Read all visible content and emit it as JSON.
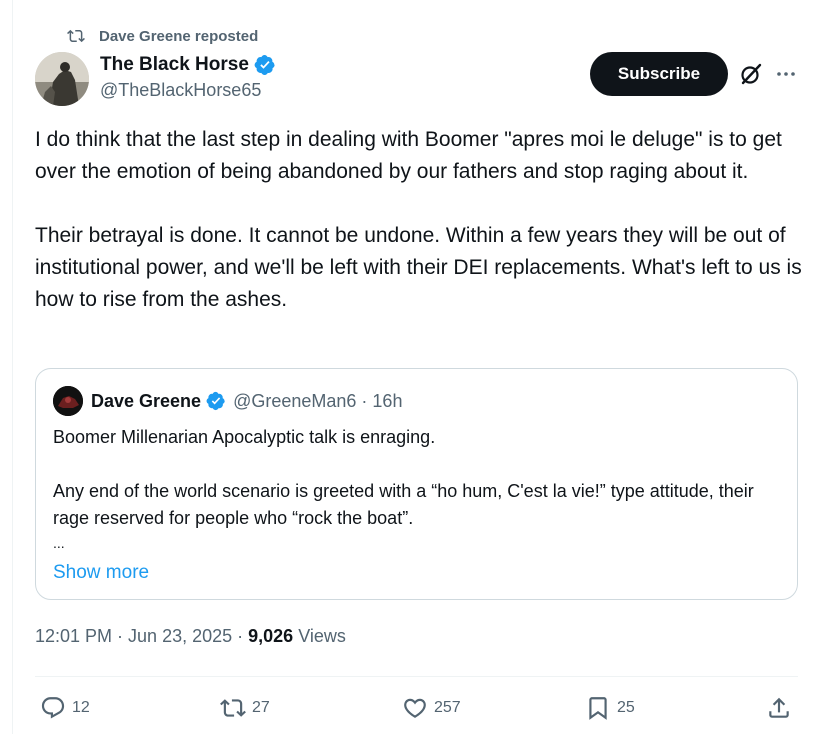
{
  "repost": {
    "text": "Dave Greene reposted",
    "icon": "repost-icon"
  },
  "author": {
    "name": "The Black Horse",
    "handle": "@TheBlackHorse65",
    "verified": true
  },
  "header_actions": {
    "subscribe_label": "Subscribe",
    "grok_icon": "grok-icon",
    "more_icon": "more-icon"
  },
  "tweet": {
    "paragraphs": [
      "I do think that the last step in dealing with Boomer \"apres moi le deluge\" is to get over the emotion of being abandoned by our fathers and stop raging about it.",
      "Their betrayal is done. It cannot be undone. Within a few years they will be out of institutional power, and we'll be left with their DEI replacements. What's left to us is how to rise from the ashes."
    ]
  },
  "quote": {
    "name": "Dave Greene",
    "handle": "@GreeneMan6",
    "separator": "·",
    "time": "16h",
    "paragraphs": [
      "Boomer Millenarian Apocalyptic talk is enraging.",
      "Any end of the world scenario is greeted with a “ho hum, C'est la vie!” type attitude, their rage reserved for people who “rock the boat”."
    ],
    "ellipsis": "...",
    "show_more": "Show more"
  },
  "meta": {
    "time": "12:01 PM",
    "sep1": "·",
    "date": "Jun 23, 2025",
    "sep2": "·",
    "views_count": "9,026",
    "views_label": "Views"
  },
  "actions": {
    "replies": "12",
    "reposts": "27",
    "likes": "257",
    "bookmarks": "25"
  },
  "colors": {
    "accent": "#1d9bf0",
    "text": "#0f1419",
    "muted": "#536471",
    "border": "#cfd9de",
    "button": "#0f1419"
  }
}
